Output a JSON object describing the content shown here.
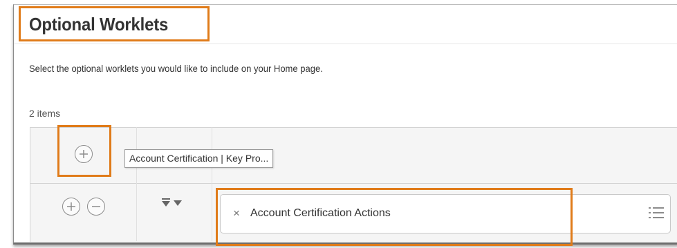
{
  "page": {
    "title": "Optional Worklets",
    "instructions": "Select the optional worklets you would like to include on your Home page.",
    "item_count": "2 items"
  },
  "grid": {
    "tooltip": "Account Certification | Key Pro...",
    "rows": [
      {
        "worklet_value": "Account Certification Actions",
        "remove_symbol": "×"
      }
    ]
  },
  "icons": {
    "add_row": "plus-circle-icon",
    "remove_row": "minus-circle-icon",
    "move_down": "move-down-icon",
    "list": "list-icon",
    "remove_value": "close-icon"
  },
  "colors": {
    "highlight": "#e07b19",
    "text": "#333333",
    "icon": "#8c8c8c"
  }
}
